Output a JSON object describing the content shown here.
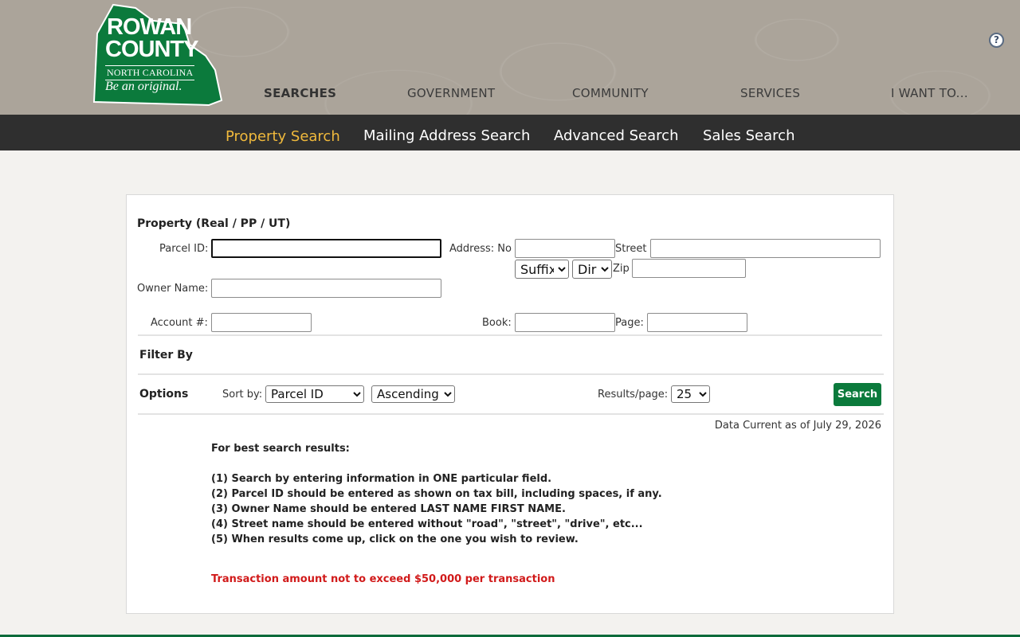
{
  "header": {
    "logo": {
      "line1": "ROWAN",
      "line2": "COUNTY",
      "state": "NORTH CAROLINA",
      "tagline": "Be an original."
    },
    "nav": [
      "SEARCHES",
      "GOVERNMENT",
      "COMMUNITY",
      "SERVICES",
      "I WANT TO..."
    ],
    "help_glyph": "?",
    "icons": [
      "help-icon"
    ],
    "colors": {
      "brand_green": "#0b7a3c",
      "active_tab": "#f0b93c",
      "subnav_bg": "#2f2f2f",
      "warning": "#d11a1a"
    }
  },
  "subnav": {
    "tabs": [
      "Property Search",
      "Mailing Address Search",
      "Advanced Search",
      "Sales Search"
    ],
    "active": "Property Search"
  },
  "form": {
    "title": "Property (Real / PP / UT)",
    "parcel_label": "Parcel ID:",
    "parcel_value": "",
    "address_label": "Address: No",
    "street_label": "Street",
    "suffix_selected": "Suffix",
    "dir_selected": "Dir",
    "zip_label": "Zip",
    "owner_label": "Owner Name:",
    "account_label": "Account #:",
    "book_label": "Book:",
    "page_label": "Page:",
    "filter_title": "Filter By",
    "options_title": "Options",
    "sort_label": "Sort by:",
    "sort_selected": "Parcel ID",
    "order_selected": "Ascending",
    "results_label": "Results/page:",
    "results_selected": "25",
    "search_button": "Search",
    "data_current": "Data Current as of July 29, 2026"
  },
  "tips": {
    "heading": "For best search results:",
    "items": [
      "(1) Search by entering information in ONE particular field.",
      "(2) Parcel ID should be entered as shown on tax bill, including spaces, if any.",
      "(3) Owner Name should be entered LAST NAME FIRST NAME.",
      "(4) Street name should be entered without \"road\", \"street\", \"drive\", etc...",
      "(5) When results come up, click on the one you wish to review."
    ],
    "warning": "Transaction amount not to exceed $50,000 per transaction"
  }
}
